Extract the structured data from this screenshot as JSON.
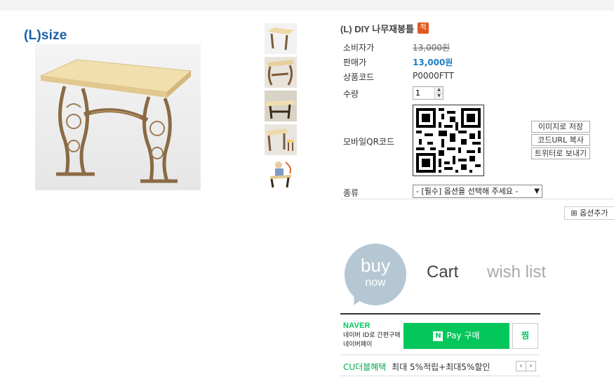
{
  "product": {
    "size_label": "(L)size",
    "title": "(L) DIY 나무재봉틀",
    "badge": "적"
  },
  "info": {
    "consumer_price_label": "소비자가",
    "consumer_price": "13,000원",
    "sale_price_label": "판매가",
    "sale_price": "13,000원",
    "code_label": "상품코드",
    "code": "P0000FTT",
    "qty_label": "수량",
    "qty_value": "1",
    "qr_label": "모바일QR코드",
    "option_label": "종류",
    "option_selected": "- [필수] 옵션을 선택해 주세요 -"
  },
  "qr_buttons": {
    "save_image": "이미지로 저장",
    "copy_url": "코드URL 복사",
    "tweet": "트위터로 보내기"
  },
  "add_option": "⊞ 옵션추가",
  "actions": {
    "buy_big": "buy",
    "buy_small": "now",
    "cart": "Cart",
    "wish": "wish list"
  },
  "npay": {
    "logo": "NAVER",
    "desc": "네이버 ID로 간편구매 네이버페이",
    "button": "Pay 구매",
    "n_mark": "N",
    "zzim": "찜"
  },
  "cu": {
    "title": "CU더블혜택",
    "text": "최대 5%적립+최대5%할인",
    "prev": "‹",
    "next": "›"
  },
  "colors": {
    "price": "#1e7fc3",
    "naver_green": "#03c75a",
    "buy_circle": "#b5c7d3",
    "size_label": "#1b5fa8"
  }
}
